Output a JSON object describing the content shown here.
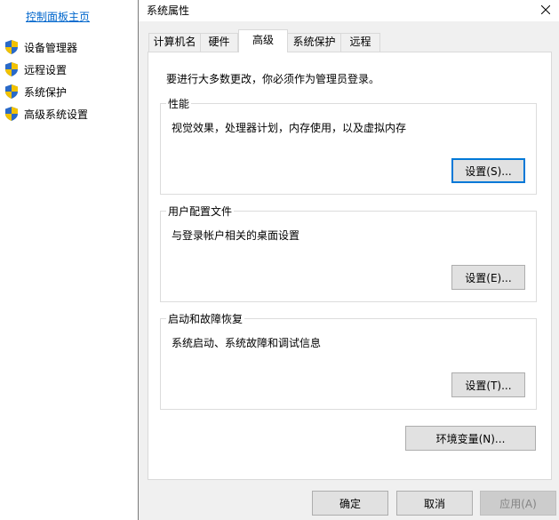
{
  "control_panel": {
    "home_link": "控制面板主页",
    "items": [
      {
        "label": "设备管理器",
        "icon": "uac-shield-icon"
      },
      {
        "label": "远程设置",
        "icon": "uac-shield-icon"
      },
      {
        "label": "系统保护",
        "icon": "uac-shield-icon"
      },
      {
        "label": "高级系统设置",
        "icon": "uac-shield-icon"
      }
    ]
  },
  "dialog": {
    "title": "系统属性",
    "tabs": [
      {
        "label": "计算机名"
      },
      {
        "label": "硬件"
      },
      {
        "label": "高级",
        "active": true
      },
      {
        "label": "系统保护"
      },
      {
        "label": "远程"
      }
    ],
    "admin_note": "要进行大多数更改，你必须作为管理员登录。",
    "groups": {
      "performance": {
        "title": "性能",
        "description": "视觉效果，处理器计划，内存使用，以及虚拟内存",
        "button": "设置(S)..."
      },
      "user_profiles": {
        "title": "用户配置文件",
        "description": "与登录帐户相关的桌面设置",
        "button": "设置(E)..."
      },
      "startup_recovery": {
        "title": "启动和故障恢复",
        "description": "系统启动、系统故障和调试信息",
        "button": "设置(T)..."
      }
    },
    "env_button": "环境变量(N)...",
    "footer": {
      "ok": "确定",
      "cancel": "取消",
      "apply": "应用(A)"
    }
  },
  "colors": {
    "link": "#0066cc",
    "focus_border": "#0078d7",
    "dialog_bg": "#f0f0f0",
    "shield_blue": "#2a6ac8",
    "shield_yellow": "#f2c200"
  }
}
